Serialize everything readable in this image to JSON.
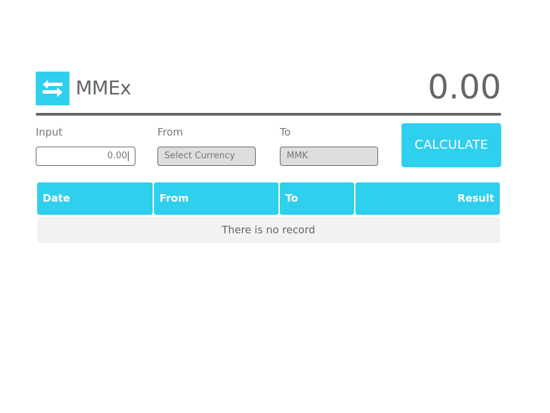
{
  "header": {
    "app_title": "MMEx",
    "total": "0.00",
    "logo_icon": "exchange-arrows-icon",
    "accent_color": "#2fcfee"
  },
  "form": {
    "input_label": "Input",
    "input_value": "0.00",
    "from_label": "From",
    "from_value": "Select Currency",
    "to_label": "To",
    "to_value": "MMK",
    "calculate_label": "CALCULATE"
  },
  "table": {
    "columns": [
      "Date",
      "From",
      "To",
      "Result"
    ],
    "empty_message": "There is no record"
  }
}
